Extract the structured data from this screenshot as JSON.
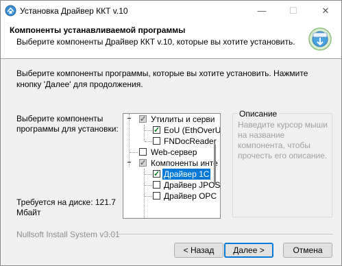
{
  "window": {
    "title": "Установка Драйвер ККТ v.10",
    "controls": {
      "minimize": "—",
      "maximize": "☐",
      "close": "✕"
    }
  },
  "header": {
    "title": "Компоненты устанавливаемой программы",
    "subtitle": "Выберите компоненты Драйвер ККТ v.10, которые вы хотите установить."
  },
  "intro": "Выберите компоненты программы, которые вы хотите установить. Нажмите кнопку 'Далее' для продолжения.",
  "select_label": "Выберите компоненты программы для установки:",
  "space_required": "Требуется на диске: 121.7 Мбайт",
  "tree": [
    {
      "label": "Утилиты и серви",
      "state": "partial"
    },
    {
      "label": "EoU (EthOverU",
      "state": "checked"
    },
    {
      "label": "FNDocReader",
      "state": "unchecked"
    },
    {
      "label": "Web-сервер",
      "state": "unchecked"
    },
    {
      "label": "Компоненты инте",
      "state": "partial"
    },
    {
      "label": "Драйвер 1С",
      "state": "checked",
      "selected": true
    },
    {
      "label": "Драйвер JPOS",
      "state": "unchecked"
    },
    {
      "label": "Драйвер OPC",
      "state": "unchecked"
    }
  ],
  "description": {
    "legend": "Описание",
    "text": "Наведите курсор мыши на название компонента, чтобы прочесть его описание."
  },
  "footer": {
    "brand": "Nullsoft Install System v3.01"
  },
  "buttons": {
    "back": "< Назад",
    "next": "Далее >",
    "cancel": "Отмена"
  },
  "colors": {
    "accent": "#0078d7",
    "window_bg": "#f0f0f0",
    "header_bg": "#ffffff"
  },
  "icons": {
    "app": "installer-icon",
    "logo": "installer-logo-icon"
  }
}
